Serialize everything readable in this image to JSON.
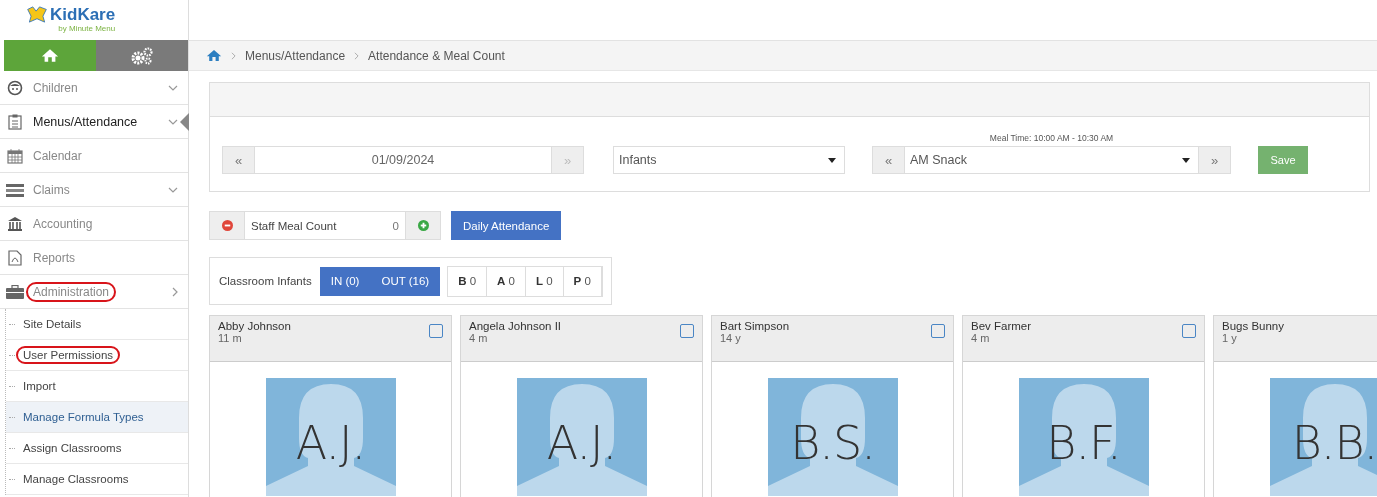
{
  "logo": {
    "name": "KidKare",
    "tagline": "by Minute Menu"
  },
  "sidebar": {
    "items": [
      {
        "label": "Children",
        "kind": "face",
        "has_submenu": true,
        "submenu_shown": false,
        "active": false,
        "circled": false
      },
      {
        "label": "Menus/Attendance",
        "kind": "clipboard",
        "has_submenu": true,
        "submenu_shown": false,
        "active": true,
        "circled": false
      },
      {
        "label": "Calendar",
        "kind": "calendar",
        "has_submenu": false,
        "active": false,
        "circled": false
      },
      {
        "label": "Claims",
        "kind": "claims",
        "has_submenu": true,
        "submenu_shown": false,
        "active": false,
        "circled": false
      },
      {
        "label": "Accounting",
        "kind": "bank",
        "has_submenu": false,
        "active": false,
        "circled": false
      },
      {
        "label": "Reports",
        "kind": "pdf",
        "has_submenu": false,
        "active": false,
        "circled": false
      },
      {
        "label": "Administration",
        "kind": "briefcase",
        "has_submenu": true,
        "submenu_shown": true,
        "active": false,
        "circled": true
      }
    ],
    "subitems": [
      {
        "label": "Site Details",
        "selected": false,
        "circled": false
      },
      {
        "label": "User Permissions",
        "selected": false,
        "circled": true
      },
      {
        "label": "Import",
        "selected": false,
        "circled": false
      },
      {
        "label": "Manage Formula Types",
        "selected": true,
        "circled": false
      },
      {
        "label": "Assign Classrooms",
        "selected": false,
        "circled": false
      },
      {
        "label": "Manage Classrooms",
        "selected": false,
        "circled": false
      }
    ]
  },
  "breadcrumb": [
    "Menus/Attendance",
    "Attendance & Meal Count"
  ],
  "filters": {
    "prev": "«",
    "date": "01/09/2024",
    "next": "»",
    "classroom": "Infants",
    "meal_time": "Meal Time: 10:00 AM - 10:30 AM",
    "meal_prev": "«",
    "meal": "AM Snack",
    "meal_next": "»",
    "save": "Save"
  },
  "staff": {
    "label": "Staff Meal Count",
    "count": "0",
    "attendance_button": "Daily Attendance"
  },
  "classroom": {
    "label": "Classroom Infants",
    "in": "IN (0)",
    "out": "OUT (16)",
    "meal_counts": [
      {
        "letter": "B",
        "count": "0"
      },
      {
        "letter": "A",
        "count": "0"
      },
      {
        "letter": "L",
        "count": "0"
      },
      {
        "letter": "P",
        "count": "0"
      }
    ]
  },
  "children": [
    {
      "name": "Abby Johnson",
      "age": "11 m",
      "initials": "A.J.",
      "checked": false
    },
    {
      "name": "Angela Johnson II",
      "age": "4 m",
      "initials": "A.J.",
      "checked": false
    },
    {
      "name": "Bart Simpson",
      "age": "14 y",
      "initials": "B.S.",
      "checked": false
    },
    {
      "name": "Bev Farmer",
      "age": "4 m",
      "initials": "B.F.",
      "checked": false
    },
    {
      "name": "Bugs Bunny",
      "age": "1 y",
      "initials": "B.B."
    }
  ]
}
